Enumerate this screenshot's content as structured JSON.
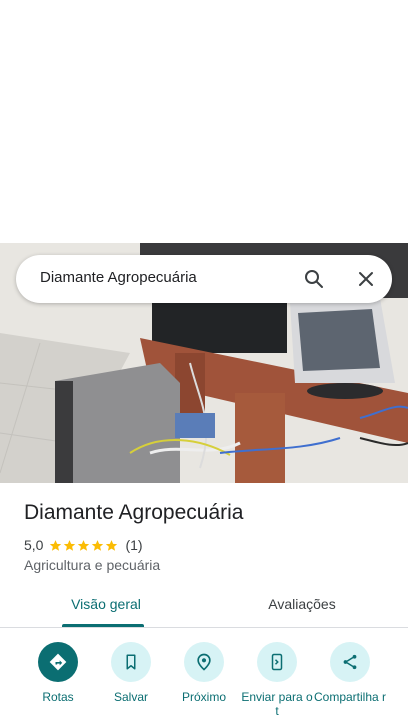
{
  "search": {
    "query": "Diamante Agropecuária"
  },
  "place": {
    "title": "Diamante Agropecuária",
    "rating": "5,0",
    "stars": 5,
    "review_count": "(1)",
    "category": "Agricultura e pecuária"
  },
  "tabs": [
    {
      "label": "Visão geral",
      "selected": true
    },
    {
      "label": "Avaliações",
      "selected": false
    }
  ],
  "actions": [
    {
      "label": "Rotas",
      "icon": "directions-icon"
    },
    {
      "label": "Salvar",
      "icon": "bookmark-icon"
    },
    {
      "label": "Próximo",
      "icon": "nearby-icon"
    },
    {
      "label": "Enviar para o t",
      "icon": "send-to-phone-icon"
    },
    {
      "label": "Compartilha r",
      "icon": "share-icon"
    }
  ],
  "colors": {
    "accent": "#0b6e72",
    "accent_light": "#d7f3f5",
    "star": "#fbbc04"
  }
}
